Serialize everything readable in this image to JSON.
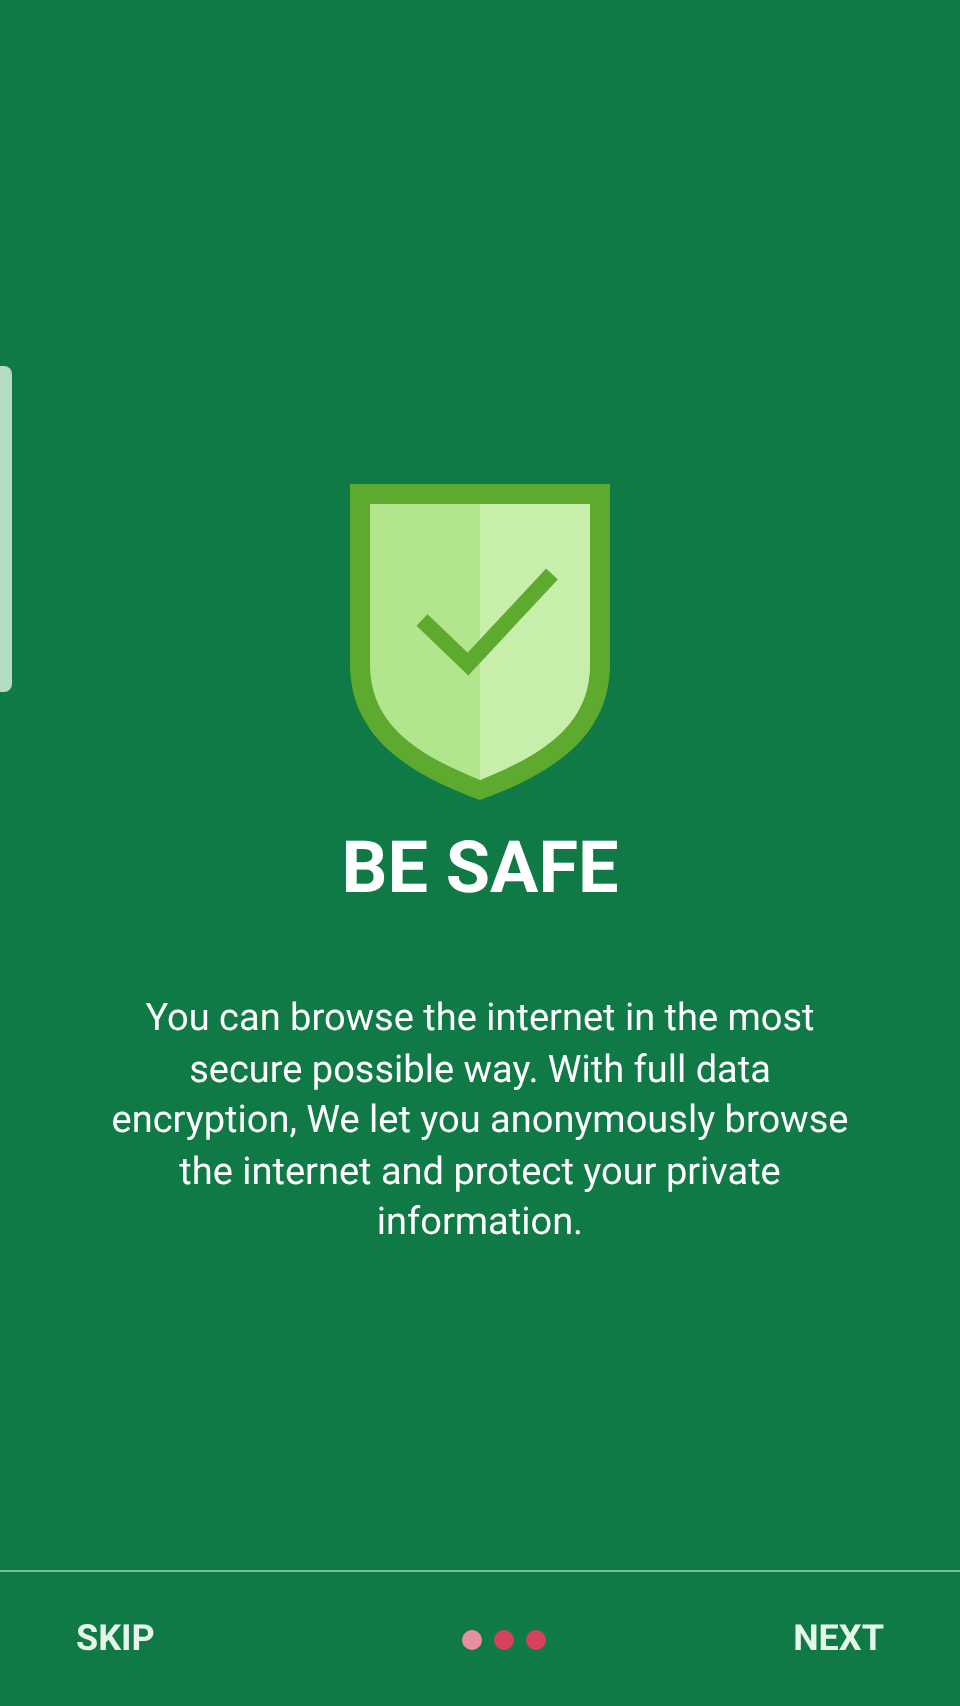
{
  "title": "BE SAFE",
  "description": "You can browse the internet in the most secure possible way. With full data encryption, We let you anonymously browse the internet and protect your private information.",
  "footer": {
    "skip": "SKIP",
    "next": "NEXT",
    "pages": [
      {
        "selected": true
      },
      {
        "selected": false
      },
      {
        "selected": false
      }
    ]
  }
}
